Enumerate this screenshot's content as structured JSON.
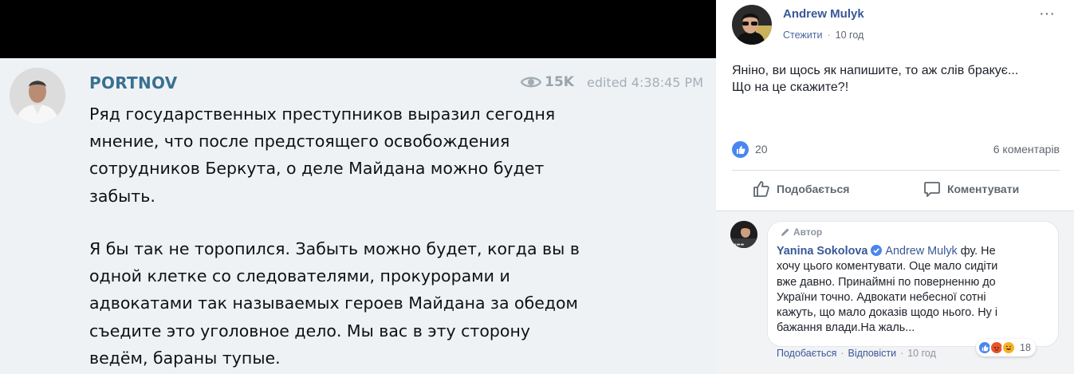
{
  "telegram": {
    "channel_name": "PORTNOV",
    "views": "15K",
    "edited": "edited 4:38:45 PM",
    "paragraph1": [
      "Ряд государственных преступников выразил сегодня",
      "мнение, что после предстоящего освобождения",
      "сотрудников Беркута, о деле Майдана можно будет",
      "забыть."
    ],
    "paragraph2": [
      "Я бы так не торопился. Забыть можно будет, когда вы в",
      "одной клетке со следователями, прокурорами и",
      "адвокатами так называемых героев Майдана за обедом",
      "съедите это уголовное дело. Мы вас в эту сторону",
      "ведём, бараны тупые."
    ]
  },
  "facebook": {
    "author": "Andrew Mulyk",
    "follow": "Стежити",
    "time": "10 год",
    "more": "···",
    "post_lines": [
      "Яніно, ви щось як напишите, то аж слів бракує...",
      "Що на це скажите?!"
    ],
    "like_count": "20",
    "comment_count": "6 коментарів",
    "like_action": "Подобається",
    "comment_action": "Коментувати",
    "comment": {
      "badge": "Автор",
      "name": "Yanina Sokolova",
      "mention": "Andrew Mulyk",
      "first_line_rest": " фу. Не",
      "lines": [
        "хочу цього коментувати. Оце мало сидіти",
        "вже давно. Принаймні по поверненню до",
        "України точно. Адвокати небесної сотні",
        "кажуть, що мало доказів щодо нього. Ну і",
        "бажання влади.На жаль..."
      ],
      "like_link": "Подобається",
      "reply_link": "Відповісти",
      "time": "10 год",
      "reactions_count": "18"
    },
    "icons": {
      "like": "thumbs-up-icon",
      "comment": "speech-bubble-icon",
      "views": "eye-icon",
      "author": "pencil-icon",
      "verified": "verified-badge-icon"
    },
    "colors": {
      "link": "#385898",
      "like_blue": "#4a86f0",
      "angry": "#e8542c",
      "haha": "#f7b125"
    }
  }
}
